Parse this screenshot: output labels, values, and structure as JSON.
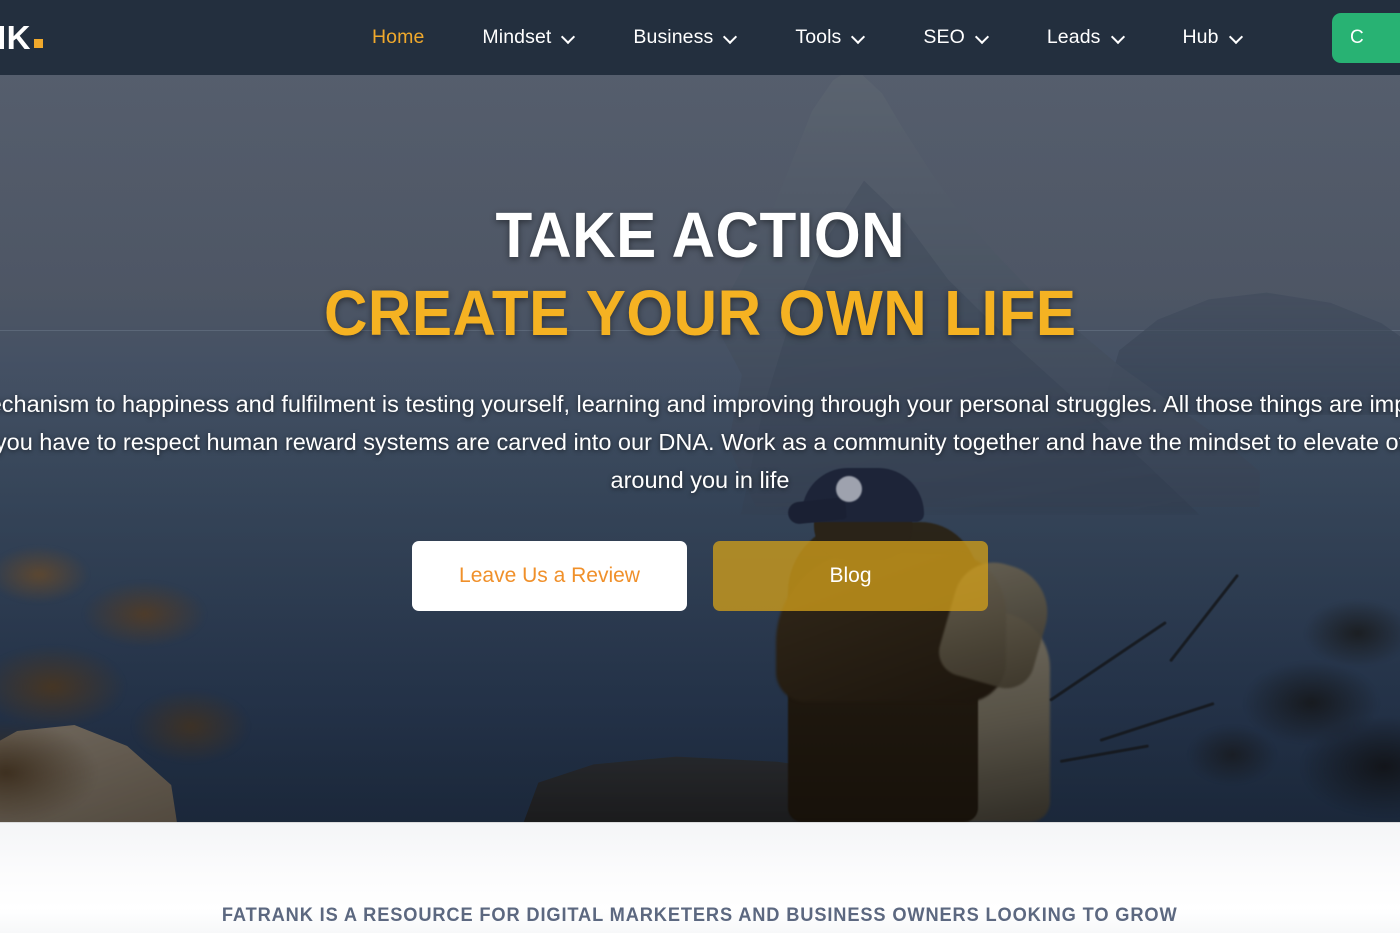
{
  "navbar": {
    "brand_text": "ANK",
    "brand_dot": "",
    "items": [
      {
        "label": "Home",
        "has_dropdown": false,
        "active": true
      },
      {
        "label": "Mindset",
        "has_dropdown": true,
        "active": false
      },
      {
        "label": "Business",
        "has_dropdown": true,
        "active": false
      },
      {
        "label": "Tools",
        "has_dropdown": true,
        "active": false
      },
      {
        "label": "SEO",
        "has_dropdown": true,
        "active": false
      },
      {
        "label": "Leads",
        "has_dropdown": true,
        "active": false
      },
      {
        "label": "Hub",
        "has_dropdown": true,
        "active": false
      }
    ],
    "cta_label": "C",
    "background_color": "#232f3e",
    "active_link_color": "#f0a92c",
    "cta_color": "#28b273"
  },
  "hero": {
    "headline_line1": "TAKE ACTION",
    "headline_line2": "CREATE YOUR OWN LIFE",
    "headline_line1_color": "#ffffff",
    "headline_line2_color": "#f5b222",
    "paragraph": "The mechanism to happiness and fulfilment is testing yourself, learning and improving through your personal struggles. All those things are imperative and you have to respect human reward systems are carved into our DNA. Work as a community together and have the mindset to elevate others around you in life",
    "buttons": [
      {
        "label": "Leave Us a Review",
        "style": "white"
      },
      {
        "label": "Blog",
        "style": "amber"
      }
    ]
  },
  "below_fold": {
    "tagline": "FATRANK IS A RESOURCE FOR DIGITAL MARKETERS AND BUSINESS OWNERS LOOKING TO GROW",
    "tagline_color": "#5c6880"
  }
}
